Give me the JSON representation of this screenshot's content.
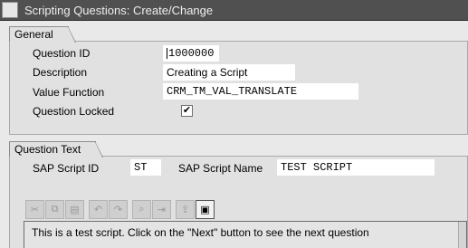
{
  "window": {
    "title": "Scripting Questions: Create/Change"
  },
  "general": {
    "tab_label": "General",
    "question_id": {
      "label": "Question ID",
      "value": "1000000"
    },
    "description": {
      "label": "Description",
      "value": "Creating a Script"
    },
    "value_function": {
      "label": "Value Function",
      "value": "CRM_TM_VAL_TRANSLATE"
    },
    "question_locked": {
      "label": "Question Locked",
      "checked": true,
      "mark": "✔"
    }
  },
  "question_text": {
    "tab_label": "Question Text",
    "script_id": {
      "label": "SAP Script ID",
      "value": "ST"
    },
    "script_name": {
      "label": "SAP Script Name",
      "value": "TEST SCRIPT"
    },
    "toolbar_icons": [
      "cut-icon",
      "copy-icon",
      "paste-icon",
      "undo-icon",
      "redo-icon",
      "find-icon",
      "find-next-icon",
      "load-local-file-icon",
      "save-local-file-icon"
    ],
    "text": "This is a test script. Click on the \"Next\" button to see the next question"
  }
}
